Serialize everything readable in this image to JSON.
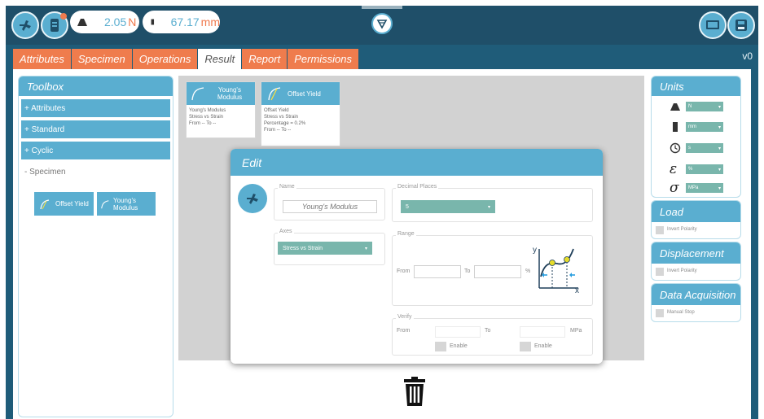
{
  "topbar": {
    "force": {
      "value": "2.05",
      "unit": "N"
    },
    "position": {
      "value": "67.17",
      "unit": "mm"
    }
  },
  "tabs": [
    {
      "label": "Attributes",
      "active": false
    },
    {
      "label": "Specimen",
      "active": false
    },
    {
      "label": "Operations",
      "active": false
    },
    {
      "label": "Result",
      "active": true
    },
    {
      "label": "Report",
      "active": false
    },
    {
      "label": "Permissions",
      "active": false
    }
  ],
  "version": "v0",
  "toolbox": {
    "title": "Toolbox",
    "sections": [
      "+ Attributes",
      "+ Standard",
      "+ Cyclic"
    ],
    "specimen_label": "- Specimen",
    "specimen_items": [
      "Offset Yield",
      "Young's Modulus"
    ]
  },
  "result_tiles": [
    {
      "title": "Young's Modulus",
      "lines": [
        "Young's Modulus",
        "Stress vs Strain",
        "From -- To --"
      ]
    },
    {
      "title": "Offset Yield",
      "lines": [
        "Offset Yield",
        "Stress vs Strain",
        "Percentage = 0.2%",
        "From -- To --"
      ]
    }
  ],
  "edit": {
    "title": "Edit",
    "name_legend": "Name",
    "name_value": "Young's Modulus",
    "axes_legend": "Axes",
    "axes_value": "Stress vs Strain",
    "decimal_legend": "Decimal Places",
    "decimal_value": "5",
    "range_legend": "Range",
    "range_from": "From",
    "range_to": "To",
    "range_unit": "%",
    "verify_legend": "Verify",
    "verify_from": "From",
    "verify_to": "To",
    "verify_unit": "MPa",
    "enable_1": "Enable",
    "enable_2": "Enable",
    "graph_y": "y",
    "graph_x": "x"
  },
  "units": {
    "title": "Units",
    "rows": [
      {
        "icon": "weight-icon",
        "value": "N"
      },
      {
        "icon": "ruler-icon",
        "value": "mm"
      },
      {
        "icon": "clock-icon",
        "value": "s"
      },
      {
        "icon": "epsilon-icon",
        "symbol": "ε",
        "value": "%"
      },
      {
        "icon": "sigma-icon",
        "symbol": "σ",
        "value": "MPa"
      }
    ]
  },
  "load": {
    "title": "Load",
    "option": "Invert Polarity"
  },
  "displacement": {
    "title": "Displacement",
    "option": "Invert Polarity"
  },
  "data_acquisition": {
    "title": "Data Acquisition",
    "option": "Manual Stop"
  },
  "colors": {
    "accent": "#5aaed0",
    "tab": "#ef7c4d",
    "frame": "#1f5c79",
    "select": "#79b6ac"
  }
}
